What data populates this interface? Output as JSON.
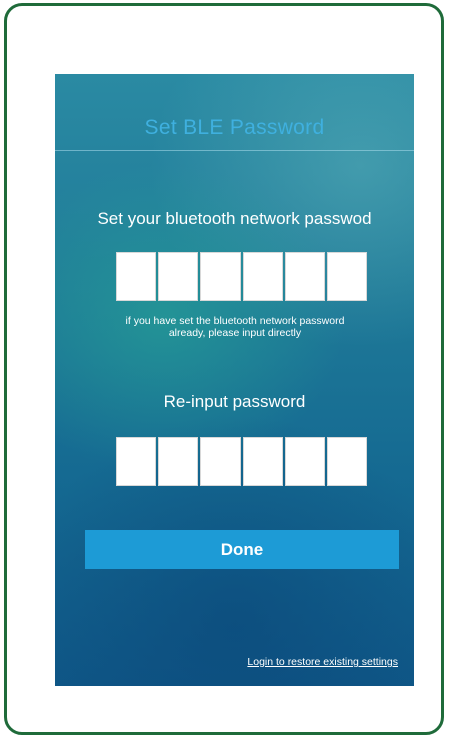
{
  "screen": {
    "title": "Set BLE Password"
  },
  "password_section": {
    "heading": "Set your bluetooth network passwod",
    "digits": 6,
    "hint_line1": "if you have set the bluetooth network password",
    "hint_line2": "already, please input directly"
  },
  "reinput_section": {
    "heading": "Re-input password",
    "digits": 6
  },
  "actions": {
    "done_label": "Done",
    "restore_link": "Login to restore existing settings"
  },
  "colors": {
    "frame_border": "#1f6b3a",
    "title_text": "#3fb0df",
    "done_button": "#1d9bd6",
    "background_top": "#2a8aa3",
    "background_bottom": "#0f5787"
  }
}
